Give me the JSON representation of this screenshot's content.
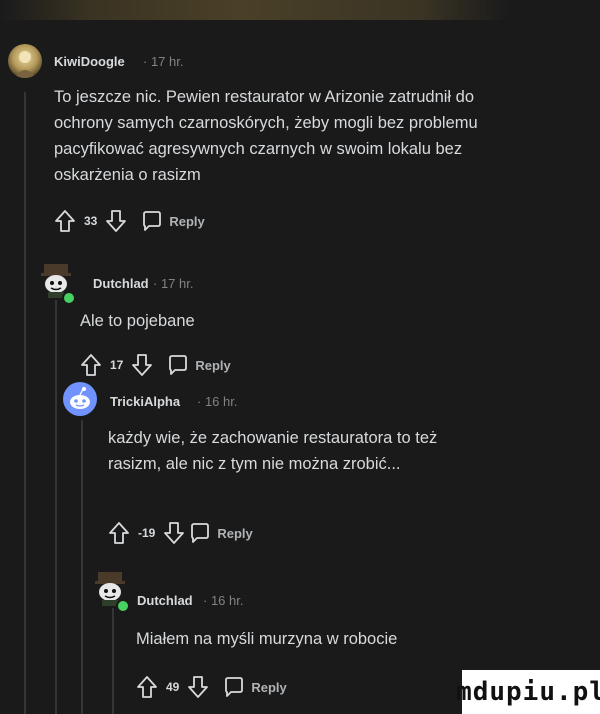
{
  "comments": [
    {
      "username": "KiwiDoogle",
      "time": "· 17 hr.",
      "lines": [
        "To jeszcze nic. Pewien restaurator w Arizonie zatrudnił do",
        "ochrony samych czarnoskórych, żeby mogli bez problemu",
        "pacyfikować agresywnych czarnych w swoim lokalu bez",
        "oskarżenia o rasizm"
      ],
      "votes": "33",
      "reply_label": "Reply"
    },
    {
      "username": "Dutchlad",
      "time": "· 17 hr.",
      "lines": [
        "Ale to pojebane"
      ],
      "votes": "17",
      "reply_label": "Reply"
    },
    {
      "username": "TrickiAlpha",
      "time": "· 16 hr.",
      "lines": [
        "każdy wie, że zachowanie restauratora to też",
        "rasizm, ale nic z tym nie można zrobić..."
      ],
      "votes": "-19",
      "reply_label": "Reply"
    },
    {
      "username": "Dutchlad",
      "time": "· 16 hr.",
      "lines": [
        "Miałem na myśli murzyna w robocie"
      ],
      "votes": "49",
      "reply_label": "Reply"
    }
  ],
  "watermark": "mdupiu.pl",
  "colors": {
    "background": "#1a1a1b",
    "online": "#46d160",
    "snoo": "#7193ff"
  },
  "icons": [
    "upvote-icon",
    "downvote-icon",
    "reply-bubble-icon"
  ]
}
